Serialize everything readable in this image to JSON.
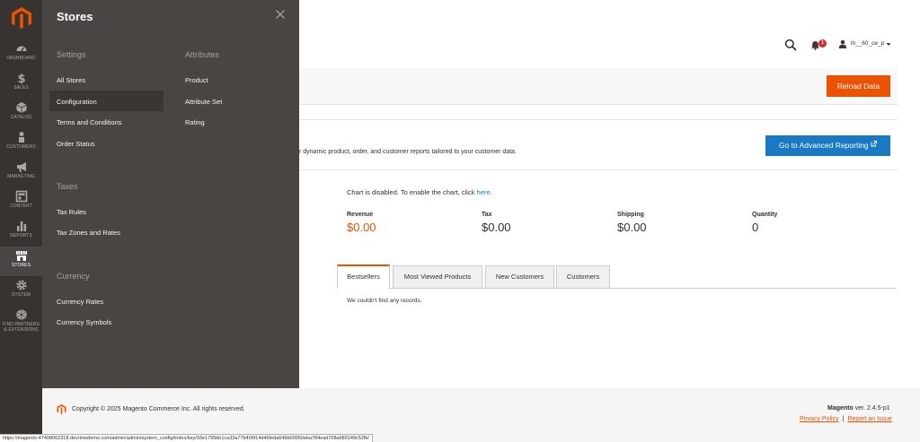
{
  "colors": {
    "nav_bg": "#373330",
    "panel_bg": "#4a4542",
    "accent_orange": "#eb5202",
    "primary_blue": "#1979c3",
    "badge_red": "#e22626"
  },
  "nav": {
    "items": [
      {
        "label": "DASHBOARD",
        "icon": "speedometer-icon"
      },
      {
        "label": "SALES",
        "icon": "dollar-icon"
      },
      {
        "label": "CATALOG",
        "icon": "cube-icon"
      },
      {
        "label": "CUSTOMERS",
        "icon": "person-icon"
      },
      {
        "label": "MARKETING",
        "icon": "megaphone-icon"
      },
      {
        "label": "CONTENT",
        "icon": "layout-icon"
      },
      {
        "label": "REPORTS",
        "icon": "bar-chart-icon"
      },
      {
        "label": "STORES",
        "icon": "storefront-icon"
      },
      {
        "label": "SYSTEM",
        "icon": "gear-icon"
      },
      {
        "label": "FIND PARTNERS",
        "label2": "& EXTENSIONS",
        "icon": "boxes-icon"
      }
    ],
    "active": "STORES"
  },
  "panel": {
    "title": "Stores",
    "settings": {
      "heading": "Settings",
      "links": [
        "All Stores",
        "Configuration",
        "Terms and Conditions",
        "Order Status"
      ]
    },
    "attributes": {
      "heading": "Attributes",
      "links": [
        "Product",
        "Attribute Set",
        "Rating"
      ]
    },
    "taxes": {
      "heading": "Taxes",
      "links": [
        "Tax Rules",
        "Tax Zones and Rates"
      ]
    },
    "currency": {
      "heading": "Currency",
      "links": [
        "Currency Rates",
        "Currency Symbols"
      ]
    },
    "highlighted": "Configuration"
  },
  "header": {
    "user_name": "lh__60_ce_p",
    "notification_count": "1"
  },
  "reload": {
    "button_label": "Reload Data"
  },
  "advanced_reporting": {
    "text": "r dynamic product, order, and customer reports tailored to your customer data.",
    "button_label": "Go to Advanced Reporting"
  },
  "dashboard": {
    "chart_note_prefix": "Chart is disabled. To enable the chart, click ",
    "chart_note_link": "here",
    "chart_note_suffix": ".",
    "totals": [
      {
        "label": "Revenue",
        "value": "$0.00"
      },
      {
        "label": "Tax",
        "value": "$0.00"
      },
      {
        "label": "Shipping",
        "value": "$0.00"
      },
      {
        "label": "Quantity",
        "value": "0"
      }
    ],
    "tabs": [
      "Bestsellers",
      "Most Viewed Products",
      "New Customers",
      "Customers"
    ],
    "active_tab": "Bestsellers",
    "empty_message": "We couldn't find any records."
  },
  "footer": {
    "copyright": "Copyright © 2025 Magento Commerce Inc. All rights reserved.",
    "brand": "Magento",
    "version": " ver. 2.4.5-p1",
    "privacy_link": "Privacy Policy",
    "separator": "|",
    "report_link": "Report an Issue"
  },
  "status_url": "https://magento-47498062318.devrimsdemo.com/admin/admin/system_config/index/key/93e1795bb1ca33a77b406f14d46feda649b00950eba784ead708a680149c52fb/"
}
